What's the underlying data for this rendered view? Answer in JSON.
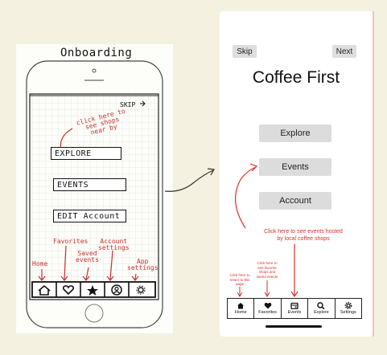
{
  "sketch": {
    "title": "Onboarding",
    "skip": "SKIP",
    "note": [
      "click here to",
      "see shops",
      "near by"
    ],
    "buttons": [
      "EXPLORE",
      "EVENTS",
      "EDIT Account"
    ],
    "labels": {
      "favorites": "Favorites",
      "account_settings": [
        "Account",
        "settings"
      ],
      "saved_events": [
        "Saved",
        "events"
      ],
      "home": "Home",
      "app_settings": [
        "App",
        "settings"
      ]
    }
  },
  "mockup": {
    "skip": "Skip",
    "next": "Next",
    "title": "Coffee First",
    "buttons": [
      "Explore",
      "Events",
      "Account"
    ],
    "note": [
      "Click here to see events hosted",
      "by local coffee shops"
    ],
    "tiny_home": [
      "Click here to",
      "return to this",
      "page"
    ],
    "tiny_favorites": [
      "Click here to",
      "see favorite",
      "shops and",
      "saved events"
    ],
    "nav": [
      {
        "label": "Home",
        "icon": "house-icon"
      },
      {
        "label": "Favorites",
        "icon": "heart-icon"
      },
      {
        "label": "Events",
        "icon": "calendar-icon"
      },
      {
        "label": "Explore",
        "icon": "search-icon"
      },
      {
        "label": "Settings",
        "icon": "gear-icon"
      }
    ]
  },
  "colors": {
    "annotation_red": "#d9312b",
    "button_gray": "#dcdcdc",
    "background": "#f4f1e0"
  }
}
